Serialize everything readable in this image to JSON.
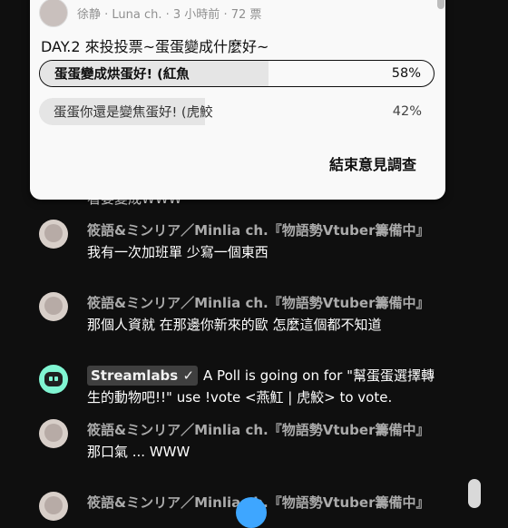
{
  "poll": {
    "author_line": "徐静 · Luna ch. · 3 小時前 · 72 票",
    "question": "DAY.2 來投投票~蛋蛋變成什麼好~",
    "options": [
      {
        "label": "蛋蛋變成烘蛋好! (紅魚",
        "percent": "58%",
        "value": 0.58
      },
      {
        "label": "蛋蛋你還是變焦蛋好! (虎鮫",
        "percent": "42%",
        "value": 0.42
      }
    ],
    "end_button": "結束意見調查"
  },
  "clipped_text": "看要變成WWW",
  "messages": [
    {
      "author": "筱語&ミンリア／Minlia ch.『物語勢Vtuber籌備中』",
      "text": "我有一次加班單 少寫一個東西"
    },
    {
      "author": "筱語&ミンリア／Minlia ch.『物語勢Vtuber籌備中』",
      "text": "那個人資就 在那邊你新來的歐 怎麼這個都不知道"
    },
    {
      "author": "Streamlabs ✓",
      "text": "A Poll is going on for \"幫蛋蛋選擇轉生的動物吧!!\" use !vote <燕魟 | 虎鮫> to vote."
    },
    {
      "author": "筱語&ミンリア／Minlia ch.『物語勢Vtuber籌備中』",
      "text": "那口氣 ... WWW"
    },
    {
      "author": "筱語&ミンリア／Minlia ch.『物語勢Vtuber籌備中』",
      "text": ""
    }
  ]
}
